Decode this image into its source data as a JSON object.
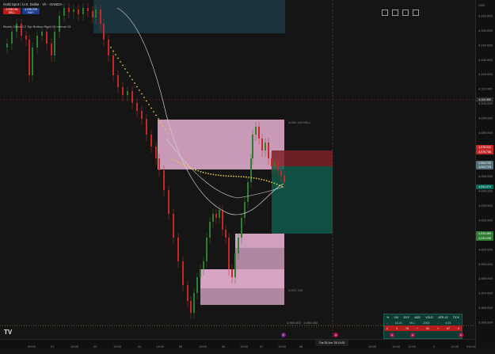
{
  "legend": {
    "title": "Gold Spot / U.S. Dollar · 1h · OANDA",
    "sell_price": "4,098.181",
    "sell_label": "SELL",
    "buy_price": "4,098.239",
    "buy_label": "BUY",
    "indicator": "Bluefx Clues 2.2 Top Bottom Right 20 normal 15"
  },
  "price_axis": {
    "currency": "USD",
    "ticks": [
      "4,160.000",
      "4,150.000",
      "4,140.000",
      "4,130.000",
      "4,120.000",
      "4,110.000",
      "4,100.000",
      "4,090.000",
      "4,080.000",
      "4,070.000",
      "4,060.000",
      "4,050.000",
      "4,040.000",
      "4,030.000",
      "4,020.000",
      "4,010.000",
      "4,000.000",
      "3,990.000",
      "3,980.000",
      "3,970.000",
      "3,960.000",
      "3,950.000"
    ],
    "tags": [
      {
        "text": "4,078.942",
        "color": "#c62828"
      },
      {
        "text": "4,078.756",
        "color": "#c62828"
      },
      {
        "text": "4,064.730",
        "color": "#546e7a"
      },
      {
        "text": "4,064.729",
        "color": "#546e7a"
      },
      {
        "text": "4,054.370",
        "color": "#00695c"
      },
      {
        "text": "4,033.489",
        "color": "#2e7d32"
      },
      {
        "text": "4,033.298",
        "color": "#2e7d32"
      }
    ],
    "crosshair_price": "4,110.000"
  },
  "time_axis": {
    "labels": [
      "09:00",
      "21",
      "13:00",
      "23",
      "13:00",
      "24",
      "13:00",
      "25",
      "13:00",
      "26",
      "13:00",
      "27",
      "13:00",
      "28",
      "13:00",
      "12:00",
      "12:00",
      "2",
      "12:00",
      "3",
      "12:00"
    ],
    "selected_date": "Tue 28 Jun '26  14:00"
  },
  "annotations": {
    "zone_top_label": "4,081.134  SELL",
    "zone_bottom_label": "3,971.703",
    "bottom_line_label": "3,959.000 · 3,959.000"
  },
  "stats": {
    "headers": [
      "%",
      "VIX",
      "DXY",
      "ADD",
      "VOLD",
      "ATR-15",
      "TICK"
    ],
    "values": [
      "-",
      "15.24",
      "99.1",
      "-2000",
      "-",
      "6.03",
      "-"
    ],
    "cells": [
      "2",
      "3",
      "75",
      "+",
      "92",
      "+",
      "57",
      "0"
    ]
  },
  "colors": {
    "background": "#151515",
    "bull": "#2e7d32",
    "bear": "#c62828",
    "supply_zone": "#f1b3d9",
    "short_loss": "#7a1f24",
    "short_profit": "#0f5f4f",
    "dots": "#e6c84b"
  }
}
